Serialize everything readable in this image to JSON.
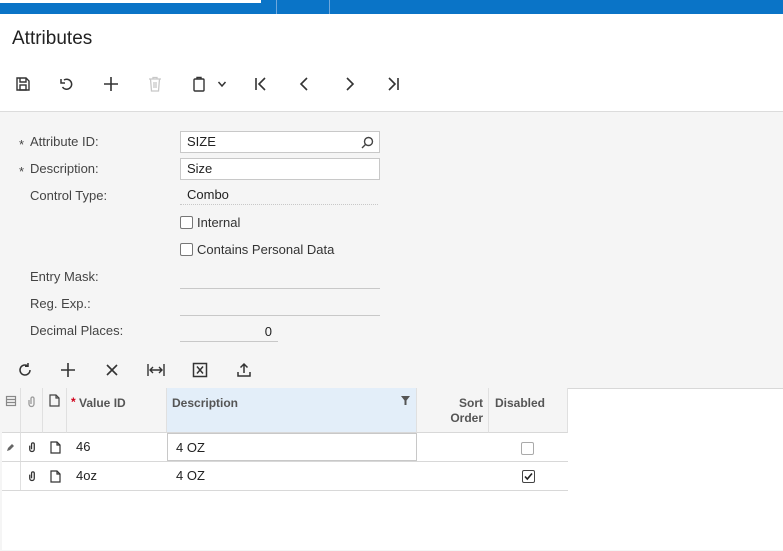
{
  "page": {
    "title": "Attributes"
  },
  "toolbar": {
    "icons": [
      "save-icon",
      "undo-icon",
      "add-icon",
      "delete-icon",
      "clipboard-icon",
      "chevron-down-icon",
      "first-record-icon",
      "previous-record-icon",
      "next-record-icon",
      "last-record-icon"
    ]
  },
  "form": {
    "attribute_id": {
      "label": "Attribute ID:",
      "value": "SIZE",
      "required_mark": "*"
    },
    "description": {
      "label": "Description:",
      "value": "Size",
      "required_mark": "*"
    },
    "control_type": {
      "label": "Control Type:",
      "value": "Combo"
    },
    "internal": {
      "label": "Internal",
      "checked": false
    },
    "personal_data": {
      "label": "Contains Personal Data",
      "checked": false
    },
    "entry_mask": {
      "label": "Entry Mask:",
      "value": ""
    },
    "reg_exp": {
      "label": "Reg. Exp.:",
      "value": ""
    },
    "decimal_places": {
      "label": "Decimal Places:",
      "value": "0"
    }
  },
  "grid_toolbar": {
    "icons": [
      "refresh-icon",
      "add-row-icon",
      "delete-row-icon",
      "fit-columns-icon",
      "export-excel-icon",
      "upload-icon"
    ]
  },
  "grid": {
    "headers": {
      "value_id": "Value ID",
      "value_id_required": "*",
      "description": "Description",
      "sort_order": "Sort Order",
      "disabled": "Disabled"
    },
    "rows": [
      {
        "value_id": "46",
        "description": "4 OZ",
        "sort_order": "",
        "disabled": false,
        "editing": true
      },
      {
        "value_id": "4oz",
        "description": "4 OZ",
        "sort_order": "",
        "disabled": true,
        "editing": false
      }
    ]
  },
  "colors": {
    "brand_blue": "#0a74c7",
    "header_bg": "#f5f5f5",
    "active_col": "#e3eef9"
  }
}
